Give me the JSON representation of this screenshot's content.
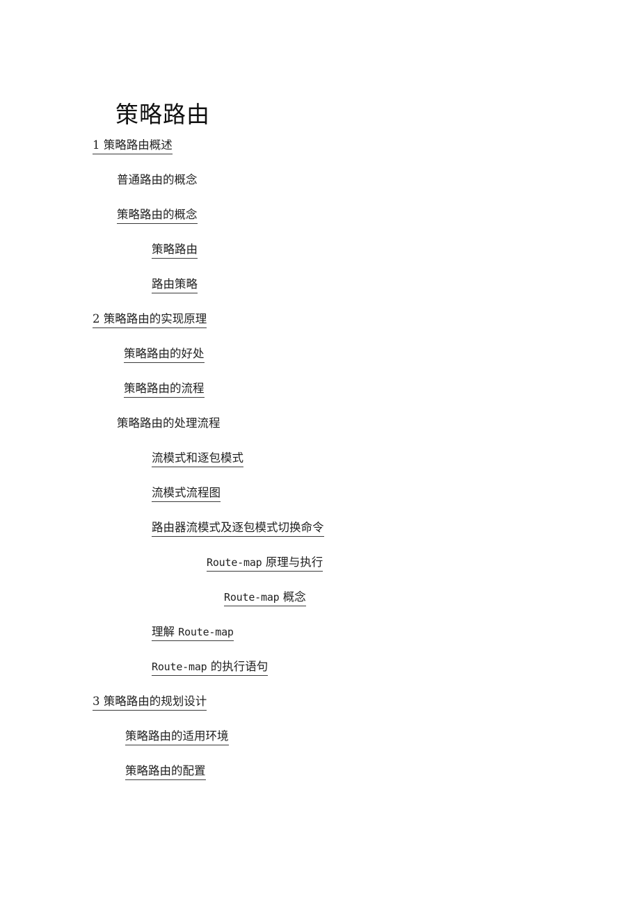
{
  "document": {
    "title": "策略路由",
    "language": "zh-CN",
    "page_background": "#ffffff",
    "text_color": "#1a1a1a",
    "link_underline_color": "#3a3a3a"
  },
  "toc": {
    "entries": [
      {
        "id": "e1",
        "text": "1 策略路由概述",
        "level": 0,
        "indent_class": "ind-0",
        "linked": true,
        "mono_prefix": "",
        "mono_suffix": ""
      },
      {
        "id": "e2",
        "text": "普通路由的概念",
        "level": 1,
        "indent_class": "ind-1",
        "linked": false,
        "mono_prefix": "",
        "mono_suffix": ""
      },
      {
        "id": "e3",
        "text": "策略路由的概念",
        "level": 1,
        "indent_class": "ind-1",
        "linked": true,
        "mono_prefix": "",
        "mono_suffix": ""
      },
      {
        "id": "e4",
        "text": "策略路由",
        "level": 2,
        "indent_class": "ind-2",
        "linked": true,
        "mono_prefix": "",
        "mono_suffix": ""
      },
      {
        "id": "e5",
        "text": "路由策略",
        "level": 2,
        "indent_class": "ind-2",
        "linked": true,
        "mono_prefix": "",
        "mono_suffix": ""
      },
      {
        "id": "e6",
        "text": "2 策略路由的实现原理",
        "level": 0,
        "indent_class": "ind-0",
        "linked": true,
        "mono_prefix": "",
        "mono_suffix": ""
      },
      {
        "id": "e7",
        "text": "策略路由的好处",
        "level": 1,
        "indent_class": "ind-1b",
        "linked": true,
        "mono_prefix": "",
        "mono_suffix": ""
      },
      {
        "id": "e8",
        "text": "策略路由的流程",
        "level": 1,
        "indent_class": "ind-1b",
        "linked": true,
        "mono_prefix": "",
        "mono_suffix": ""
      },
      {
        "id": "e9",
        "text": "策略路由的处理流程",
        "level": 1,
        "indent_class": "ind-1",
        "linked": false,
        "mono_prefix": "",
        "mono_suffix": ""
      },
      {
        "id": "e10",
        "text": "流模式和逐包模式",
        "level": 2,
        "indent_class": "ind-2",
        "linked": true,
        "mono_prefix": "",
        "mono_suffix": ""
      },
      {
        "id": "e11",
        "text": "流模式流程图",
        "level": 2,
        "indent_class": "ind-2",
        "linked": true,
        "mono_prefix": "",
        "mono_suffix": ""
      },
      {
        "id": "e12",
        "text": "路由器流模式及逐包模式切换命令",
        "level": 2,
        "indent_class": "ind-2",
        "linked": true,
        "mono_prefix": "",
        "mono_suffix": ""
      },
      {
        "id": "e13",
        "text": " 原理与执行",
        "level": 3,
        "indent_class": "ind-4",
        "linked": true,
        "mono_prefix": "Route-map",
        "mono_suffix": ""
      },
      {
        "id": "e14",
        "text": " 概念",
        "level": 4,
        "indent_class": "ind-5",
        "linked": true,
        "mono_prefix": "Route-map",
        "mono_suffix": ""
      },
      {
        "id": "e15",
        "text": "理解 ",
        "level": 2,
        "indent_class": "ind-2",
        "linked": true,
        "mono_prefix": "",
        "mono_suffix": "Route-map"
      },
      {
        "id": "e16",
        "text": " 的执行语句",
        "level": 2,
        "indent_class": "ind-2",
        "linked": true,
        "mono_prefix": "Route-map",
        "mono_suffix": ""
      },
      {
        "id": "e17",
        "text": "3 策略路由的规划设计",
        "level": 0,
        "indent_class": "ind-0",
        "linked": true,
        "mono_prefix": "",
        "mono_suffix": ""
      },
      {
        "id": "e18",
        "text": "策略路由的适用环境",
        "level": 1,
        "indent_class": "ind-3",
        "linked": true,
        "mono_prefix": "",
        "mono_suffix": ""
      },
      {
        "id": "e19",
        "text": "策略路由的配置",
        "level": 1,
        "indent_class": "ind-3",
        "linked": true,
        "mono_prefix": "",
        "mono_suffix": ""
      }
    ]
  }
}
